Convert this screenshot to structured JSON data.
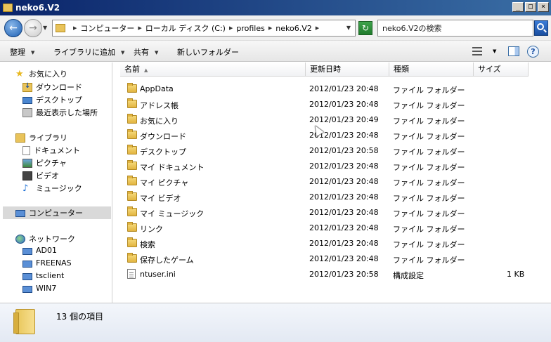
{
  "window": {
    "title": "neko6.V2"
  },
  "window_buttons": {
    "minimize": "_",
    "maximize": "□",
    "close": "×"
  },
  "address": {
    "crumbs": [
      "コンピューター",
      "ローカル ディスク (C:)",
      "profiles",
      "neko6.V2"
    ]
  },
  "search": {
    "placeholder": "neko6.V2の検索"
  },
  "toolbar": {
    "organize": "整理",
    "add_to_library": "ライブラリに追加",
    "share": "共有",
    "new_folder": "新しいフォルダー"
  },
  "nav": {
    "favorites": {
      "label": "お気に入り",
      "items": [
        "ダウンロード",
        "デスクトップ",
        "最近表示した場所"
      ]
    },
    "libraries": {
      "label": "ライブラリ",
      "items": [
        "ドキュメント",
        "ピクチャ",
        "ビデオ",
        "ミュージック"
      ]
    },
    "computer": {
      "label": "コンピューター"
    },
    "network": {
      "label": "ネットワーク",
      "items": [
        "AD01",
        "FREENAS",
        "tsclient",
        "WIN7"
      ]
    }
  },
  "columns": {
    "name": "名前",
    "date": "更新日時",
    "type": "種類",
    "size": "サイズ"
  },
  "files": [
    {
      "name": "AppData",
      "date": "2012/01/23 20:48",
      "type": "ファイル フォルダー",
      "size": "",
      "icon": "folder-icon"
    },
    {
      "name": "アドレス帳",
      "date": "2012/01/23 20:48",
      "type": "ファイル フォルダー",
      "size": "",
      "icon": "folder-icon"
    },
    {
      "name": "お気に入り",
      "date": "2012/01/23 20:49",
      "type": "ファイル フォルダー",
      "size": "",
      "icon": "folder-icon"
    },
    {
      "name": "ダウンロード",
      "date": "2012/01/23 20:48",
      "type": "ファイル フォルダー",
      "size": "",
      "icon": "folder-icon"
    },
    {
      "name": "デスクトップ",
      "date": "2012/01/23 20:58",
      "type": "ファイル フォルダー",
      "size": "",
      "icon": "folder-icon"
    },
    {
      "name": "マイ ドキュメント",
      "date": "2012/01/23 20:48",
      "type": "ファイル フォルダー",
      "size": "",
      "icon": "folder-icon"
    },
    {
      "name": "マイ ピクチャ",
      "date": "2012/01/23 20:48",
      "type": "ファイル フォルダー",
      "size": "",
      "icon": "folder-icon"
    },
    {
      "name": "マイ ビデオ",
      "date": "2012/01/23 20:48",
      "type": "ファイル フォルダー",
      "size": "",
      "icon": "folder-icon"
    },
    {
      "name": "マイ ミュージック",
      "date": "2012/01/23 20:48",
      "type": "ファイル フォルダー",
      "size": "",
      "icon": "folder-icon"
    },
    {
      "name": "リンク",
      "date": "2012/01/23 20:48",
      "type": "ファイル フォルダー",
      "size": "",
      "icon": "folder-icon"
    },
    {
      "name": "検索",
      "date": "2012/01/23 20:48",
      "type": "ファイル フォルダー",
      "size": "",
      "icon": "folder-icon"
    },
    {
      "name": "保存したゲーム",
      "date": "2012/01/23 20:48",
      "type": "ファイル フォルダー",
      "size": "",
      "icon": "folder-icon"
    },
    {
      "name": "ntuser.ini",
      "date": "2012/01/23 20:58",
      "type": "構成設定",
      "size": "1 KB",
      "icon": "ini-file-icon"
    }
  ],
  "status": {
    "text": "13 個の項目"
  },
  "icons": {
    "back": "back-arrow-icon",
    "forward": "forward-arrow-icon",
    "refresh": "refresh-icon",
    "search": "search-icon",
    "views": "views-icon",
    "preview_pane": "preview-pane-icon",
    "help": "help-icon"
  }
}
